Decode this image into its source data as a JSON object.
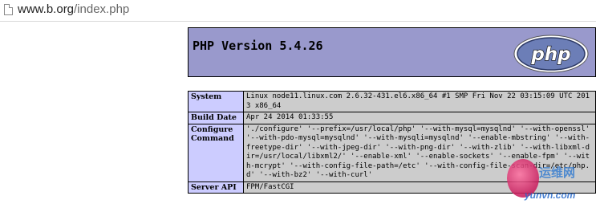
{
  "browser": {
    "address_host": "www.b.org",
    "address_path": "/index.php"
  },
  "header": {
    "title": "PHP Version 5.4.26",
    "logo_text": "php"
  },
  "info": [
    {
      "key": "System",
      "value": "Linux node11.linux.com 2.6.32-431.el6.x86_64 #1 SMP Fri Nov 22 03:15:09 UTC 2013 x86_64"
    },
    {
      "key": "Build Date",
      "value": "Apr 24 2014 01:33:55"
    },
    {
      "key": "Configure Command",
      "value": "'./configure' '--prefix=/usr/local/php' '--with-mysql=mysqlnd' '--with-openssl' '--with-pdo-mysql=mysqlnd' '--with-mysqli=mysqlnd' '--enable-mbstring' '--with-freetype-dir' '--with-jpeg-dir' '--with-png-dir' '--with-zlib' '--with-libxml-dir=/usr/local/libxml2/' '--enable-xml' '--enable-sockets' '--enable-fpm' '--with-mcrypt' '--with-config-file-path=/etc' '--with-config-file-scan-dir=/etc/php.d' '--with-bz2' '--with-curl'"
    },
    {
      "key": "Server API",
      "value": "FPM/FastCGI"
    }
  ],
  "watermark": {
    "title": "运维网",
    "url": "yunvn.com"
  },
  "colors": {
    "header_bg": "#9999cc",
    "key_bg": "#ccccff",
    "value_bg": "#cccccc"
  },
  "icons": [
    "page-icon",
    "php-logo"
  ]
}
